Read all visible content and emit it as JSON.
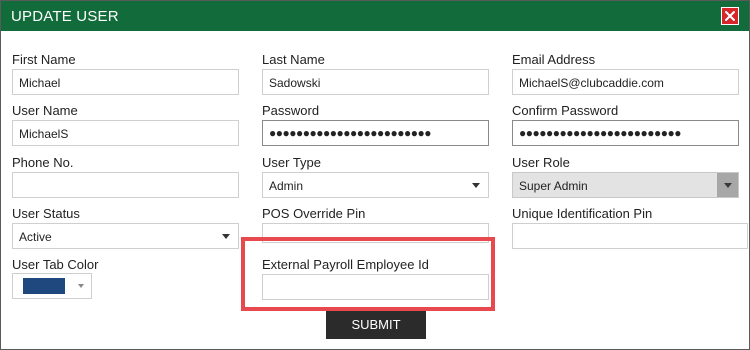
{
  "dialog": {
    "title": "UPDATE USER",
    "submit_label": "SUBMIT"
  },
  "fields": {
    "first_name": {
      "label": "First Name",
      "value": "Michael"
    },
    "last_name": {
      "label": "Last Name",
      "value": "Sadowski"
    },
    "email": {
      "label": "Email Address",
      "value": "MichaelS@clubcaddie.com"
    },
    "user_name": {
      "label": "User Name",
      "value": "MichaelS"
    },
    "password": {
      "label": "Password",
      "value": "●●●●●●●●●●●●●●●●●●●●●●●●"
    },
    "confirm_password": {
      "label": "Confirm Password",
      "value": "●●●●●●●●●●●●●●●●●●●●●●●●"
    },
    "phone": {
      "label": "Phone No.",
      "value": ""
    },
    "user_type": {
      "label": "User Type",
      "value": "Admin"
    },
    "user_role": {
      "label": "User Role",
      "value": "Super Admin"
    },
    "user_status": {
      "label": "User Status",
      "value": "Active"
    },
    "pos_override_pin": {
      "label": "POS Override Pin",
      "value": ""
    },
    "unique_id_pin": {
      "label": "Unique Identification Pin",
      "value": ""
    },
    "user_tab_color": {
      "label": "User Tab Color",
      "value": "#1f487e"
    },
    "external_payroll_id": {
      "label": "External Payroll Employee Id",
      "value": ""
    }
  },
  "colors": {
    "titlebar": "#116b3b",
    "close_button": "#d7262b",
    "highlight": "#e8494e",
    "submit_button": "#2b2b2b"
  },
  "icons": {
    "close": "close-icon",
    "dropdown": "chevron-down-icon"
  }
}
